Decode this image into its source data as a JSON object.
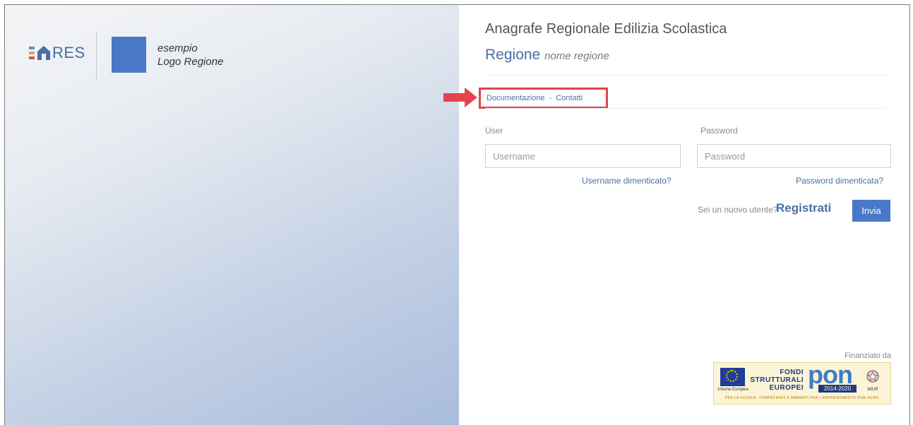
{
  "brand": {
    "ares_logo_text": "RES",
    "region_logo_line1": "esempio",
    "region_logo_line2": "Logo Regione"
  },
  "header": {
    "app_title": "Anagrafe Regionale Edilizia Scolastica",
    "region_label": "Regione",
    "region_name": "nome regione"
  },
  "links": {
    "documentation": "Documentazione",
    "separator": "-",
    "contacts": "Contatti"
  },
  "login": {
    "user_label": "User",
    "user_placeholder": "Username",
    "user_value": "",
    "forgot_username": "Username dimenticato?",
    "password_label": "Password",
    "password_placeholder": "Password",
    "password_value": "",
    "forgot_password": "Password dimenticata?",
    "new_user_text": "Sei un nuovo utente?",
    "register_label": "Registrati",
    "submit_label": "Invia"
  },
  "footer": {
    "funded_by": "Finanziato da",
    "eu_caption": "Unione Europea",
    "fondi_line1": "FONDI",
    "fondi_line2": "STRUTTURALI",
    "fondi_line3": "EUROPEI",
    "pon_text": "pon",
    "pon_years": "2014-2020",
    "miur_caption": "MIUR",
    "ribbon_text": "PER LA SCUOLA - COMPETENZE E AMBIENTI PER L'APPRENDIMENTO (FSE-FESR)"
  },
  "colors": {
    "accent": "#4a78c8",
    "link": "#4a6fa5",
    "highlight": "#e3434d"
  }
}
